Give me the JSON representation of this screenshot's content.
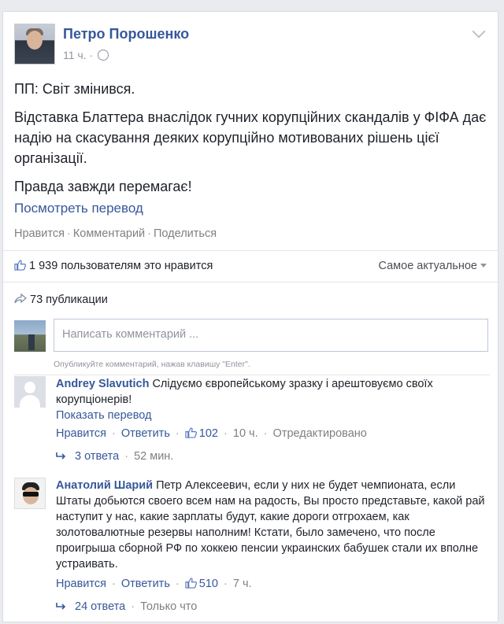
{
  "post": {
    "author": "Петро Порошенко",
    "time": "11 ч.",
    "meta_sep": "·",
    "paragraphs": [
      "ПП: Світ змінився.",
      "Відставка Блаттера внаслідок гучних корупційних скандалів у ФІФА дає надію на скасування деяких корупційно мотивованих рішень цієї організації.",
      "Правда завжди перемагає!"
    ],
    "translate_label": "Посмотреть перевод",
    "actions": {
      "like": "Нравится",
      "comment": "Комментарий",
      "share": "Поделиться",
      "sep": "·"
    }
  },
  "summary": {
    "likes_text": "1 939 пользователям это нравится",
    "sort_label": "Самое актуальное",
    "shares_text": "73 публикации"
  },
  "compose": {
    "placeholder": "Написать комментарий ...",
    "hint": "Опубликуйте комментарий, нажав клавишу \"Enter\"."
  },
  "comments": [
    {
      "name": "Andrey Slavutich",
      "text": "Слідуємо європейському зразку і арештовуємо своїх корупціонерів!",
      "translate": "Показать перевод",
      "like": "Нравится",
      "reply": "Ответить",
      "likes": "102",
      "time": "10 ч.",
      "edited": "Отредактировано",
      "replies": "3 ответа",
      "replies_time": "52 мин."
    },
    {
      "name": "Анатолий Шарий",
      "text": "Петр Алексеевич, если у них не будет чемпионата, если Штаты добьются своего всем нам на радость, Вы просто представьте, какой рай наступит у нас, какие зарплаты будут, какие дороги отгрохаем, как золотовалютные резервы наполним! Кстати, было замечено, что после проигрыша сборной РФ по хоккею пенсии украинских бабушек стали их вполне устраивать.",
      "like": "Нравится",
      "reply": "Ответить",
      "likes": "510",
      "time": "7 ч.",
      "replies": "24 ответа",
      "replies_time": "Только что"
    }
  ],
  "colors": {
    "link": "#365899",
    "muted": "#7f7f7f",
    "text": "#1d2129",
    "background": "#e9ebee"
  }
}
